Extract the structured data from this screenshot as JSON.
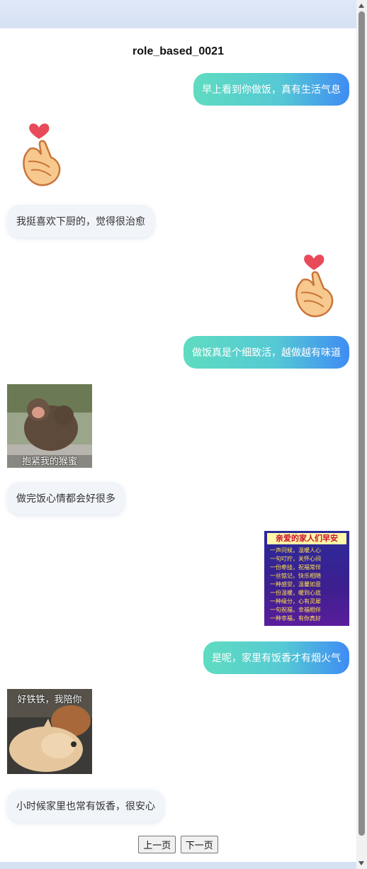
{
  "header": {
    "title": "role_based_0021"
  },
  "messages": [
    {
      "side": "right",
      "type": "text",
      "text": "早上看到你做饭，真有生活气息"
    },
    {
      "side": "left",
      "type": "sticker",
      "icon": "finger-heart-icon"
    },
    {
      "side": "left",
      "type": "text",
      "text": "我挺喜欢下厨的，觉得很治愈"
    },
    {
      "side": "right",
      "type": "sticker",
      "icon": "finger-heart-icon"
    },
    {
      "side": "right",
      "type": "text",
      "text": "做饭真是个细致活，越做越有味道"
    },
    {
      "side": "left",
      "type": "sticker",
      "caption": "抱紧我的猴蜜"
    },
    {
      "side": "left",
      "type": "text",
      "text": "做完饭心情都会好很多"
    },
    {
      "side": "right",
      "type": "sticker",
      "caption": "亲爱的家人们早安",
      "lines": [
        "一声问候，温暖人心",
        "一句叮咛，关怀心间",
        "一份牵挂，祝福常伴",
        "一丝惦记，快乐相随",
        "一种感觉，温馨如意",
        "一份温暖，暖到心底",
        "一种缘分，心有灵犀",
        "一句祝福，幸福相伴",
        "一种幸福，有你真好"
      ]
    },
    {
      "side": "right",
      "type": "text",
      "text": "是呢，家里有饭香才有烟火气"
    },
    {
      "side": "left",
      "type": "sticker",
      "caption": "好铁铁，我陪你"
    },
    {
      "side": "left",
      "type": "text",
      "text": "小时候家里也常有饭香，很安心"
    }
  ],
  "pagination": {
    "prev_label": "上一页",
    "next_label": "下一页"
  },
  "colors": {
    "bubble_gradient_start": "#5fdcc0",
    "bubble_gradient_end": "#3f8cf4",
    "left_bubble": "#f1f4f9"
  }
}
